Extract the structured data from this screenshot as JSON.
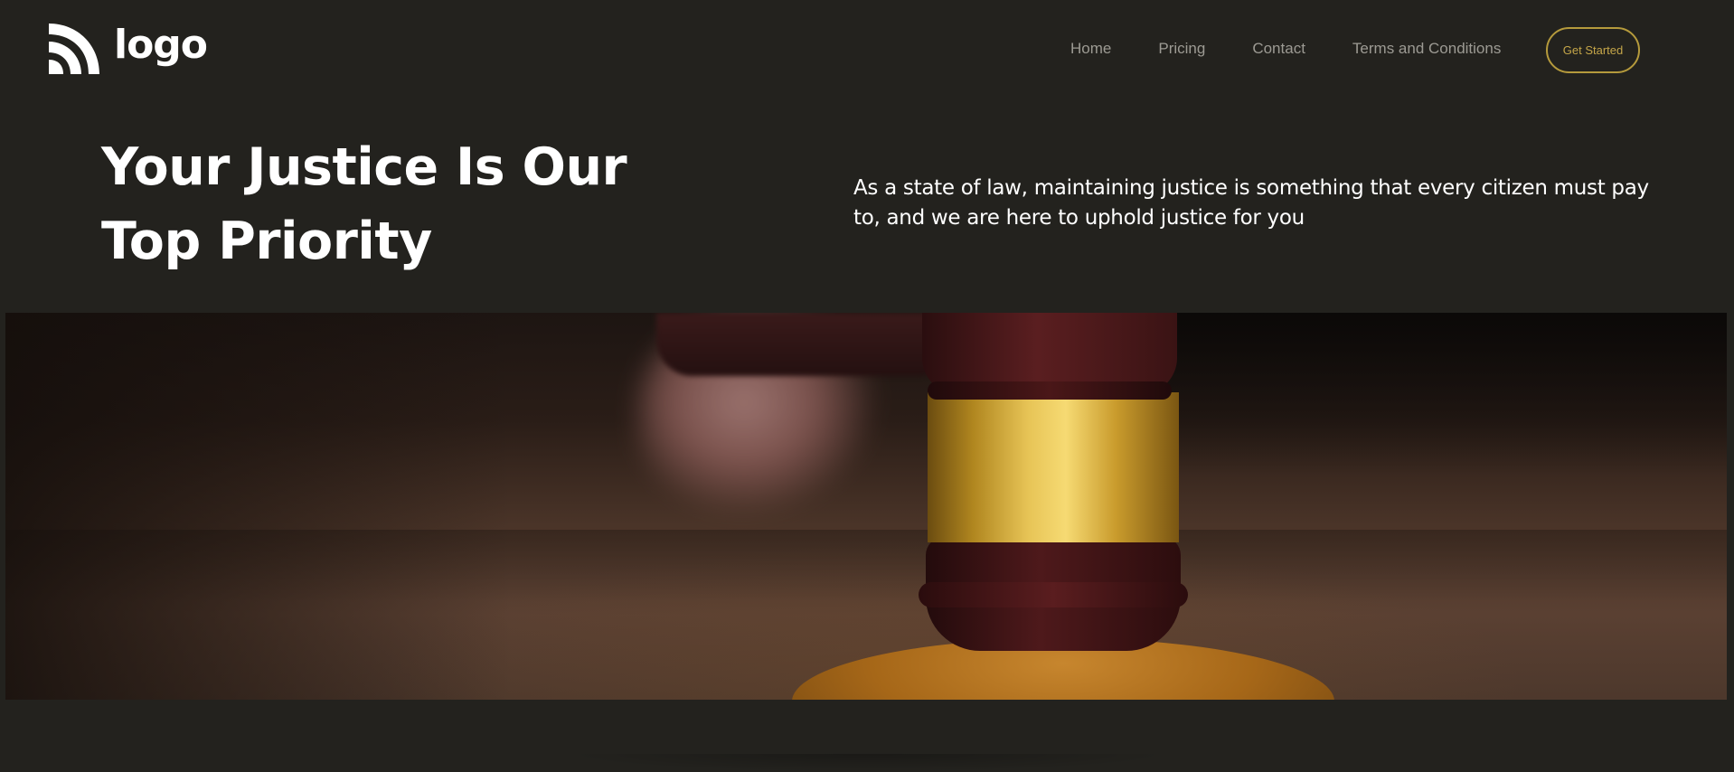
{
  "header": {
    "logo_text": "logo",
    "nav": [
      {
        "label": "Home"
      },
      {
        "label": "Pricing"
      },
      {
        "label": "Contact"
      },
      {
        "label": "Terms and Conditions"
      }
    ],
    "cta_label": "Get Started"
  },
  "hero": {
    "title_line1": "Your Justice Is Our",
    "title_line2": "Top Priority",
    "description": "As a state of law, maintaining justice is something that every citizen must pay to, and we are here to uphold justice for you",
    "image_subject": "gavel"
  },
  "colors": {
    "background": "#23221e",
    "accent": "#c5a649",
    "nav_text": "#9c9a93",
    "heading_text": "#ffffff"
  },
  "icons": {
    "logo": "signal-arcs-logo-icon"
  }
}
